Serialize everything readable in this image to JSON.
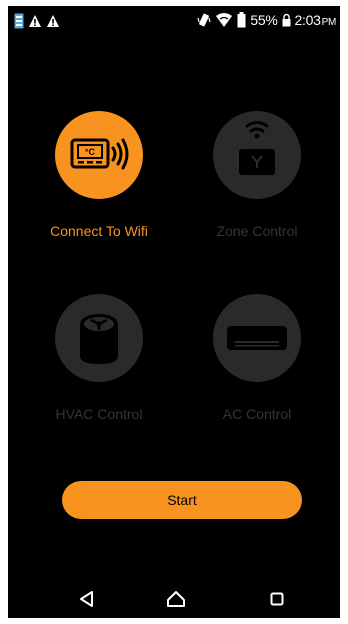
{
  "status_bar": {
    "battery_percent": "55%",
    "time": "2:03",
    "ampm": "PM",
    "left_icons": [
      "sim-card-icon",
      "alert-triangle-icon",
      "alert-triangle-icon"
    ],
    "right_icons": [
      "vibrate-icon",
      "wifi-icon",
      "battery-icon",
      "lock-icon"
    ]
  },
  "tiles": [
    {
      "label": "Connect To Wifi",
      "icon": "thermostat-wifi-icon",
      "active": true
    },
    {
      "label": "Zone Control",
      "icon": "wifi-router-icon",
      "active": false
    },
    {
      "label": "HVAC Control",
      "icon": "hvac-unit-icon",
      "active": false
    },
    {
      "label": "AC Control",
      "icon": "air-conditioner-icon",
      "active": false
    }
  ],
  "start_button": {
    "label": "Start"
  },
  "nav": {
    "icons": [
      "back-icon",
      "home-icon",
      "recents-icon"
    ]
  },
  "colors": {
    "accent": "#f7931e",
    "background": "#000000",
    "inactive_circle": "#2a2a2a",
    "inactive_text": "#353535"
  }
}
